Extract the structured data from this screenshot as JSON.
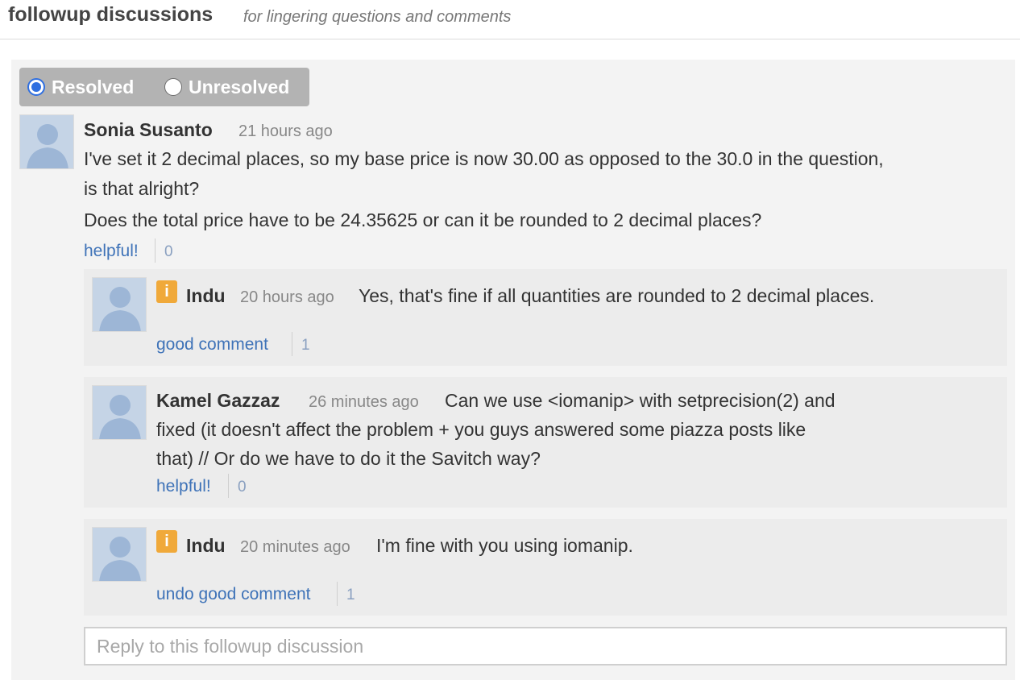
{
  "header": {
    "title": "followup discussions",
    "subtitle": "for lingering questions and comments"
  },
  "filter": {
    "resolved_label": "Resolved",
    "unresolved_label": "Unresolved",
    "selected": "Resolved"
  },
  "followup": {
    "author": "Sonia Susanto",
    "time": "21 hours ago",
    "line1": "I've set it 2 decimal places, so my base price is now 30.00 as opposed to the 30.0 in the question,",
    "line2": "is that alright?",
    "line3": "Does the total price have to be 24.35625 or can it be rounded to 2 decimal places?",
    "action_label": "helpful!",
    "action_count": "0"
  },
  "replies": [
    {
      "author": "Indu",
      "instructor": true,
      "badge": "i",
      "time": "20 hours ago",
      "text": "Yes, that's fine if all quantities are rounded to 2 decimal places.",
      "action_label": "good comment",
      "action_count": "1"
    },
    {
      "author": "Kamel Gazzaz",
      "instructor": false,
      "time": "26 minutes ago",
      "text_line1": "Can we use <iomanip> with setprecision(2) and",
      "text_line2": "fixed (it doesn't affect the problem + you guys answered some piazza posts like",
      "text_line3": "that) // Or do we have to do it the Savitch way?",
      "action_label": "helpful!",
      "action_count": "0"
    },
    {
      "author": "Indu",
      "instructor": true,
      "badge": "i",
      "time": "20 minutes ago",
      "text": "I'm fine with you using iomanip.",
      "action_label": "undo good comment",
      "action_count": "1"
    }
  ],
  "reply_input": {
    "placeholder": "Reply to this followup discussion"
  },
  "colors": {
    "link": "#3f73b8",
    "instructor_badge": "#f0a93a",
    "radio_accent": "#2f6fe0"
  }
}
